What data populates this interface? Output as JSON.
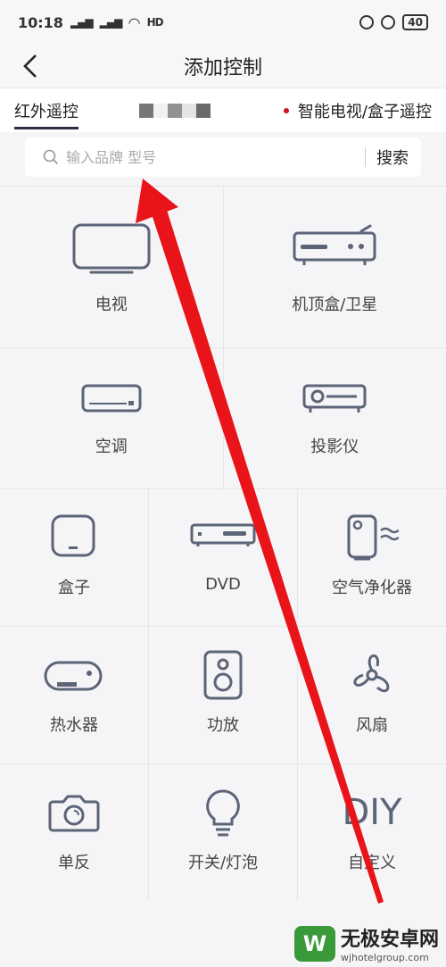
{
  "status": {
    "time": "10:18",
    "signal1": "4G",
    "signal2": "2G",
    "hd": "HD",
    "battery": "40"
  },
  "header": {
    "title": "添加控制"
  },
  "tabs": [
    {
      "label": "红外遥控"
    },
    {
      "label": "智能电视/盒子遥控"
    }
  ],
  "search": {
    "placeholder": "输入品牌 型号",
    "button": "搜索"
  },
  "devices": [
    {
      "label": "电视",
      "icon": "tv-icon"
    },
    {
      "label": "机顶盒/卫星",
      "icon": "set-top-box-icon"
    },
    {
      "label": "空调",
      "icon": "air-conditioner-icon"
    },
    {
      "label": "投影仪",
      "icon": "projector-icon"
    },
    {
      "label": "盒子",
      "icon": "box-icon"
    },
    {
      "label": "DVD",
      "icon": "dvd-icon"
    },
    {
      "label": "空气净化器",
      "icon": "air-purifier-icon"
    },
    {
      "label": "热水器",
      "icon": "water-heater-icon"
    },
    {
      "label": "功放",
      "icon": "speaker-icon"
    },
    {
      "label": "风扇",
      "icon": "fan-icon"
    },
    {
      "label": "单反",
      "icon": "camera-icon"
    },
    {
      "label": "开关/灯泡",
      "icon": "bulb-icon"
    },
    {
      "label": "自定义",
      "icon": "diy-icon",
      "glyph": "DIY"
    }
  ],
  "watermark": {
    "title": "无极安卓网",
    "url": "wjhotelgroup.com"
  },
  "colors": {
    "icon": "#5c6478",
    "accent_red": "#d0101a",
    "arrow": "#e8141a"
  }
}
